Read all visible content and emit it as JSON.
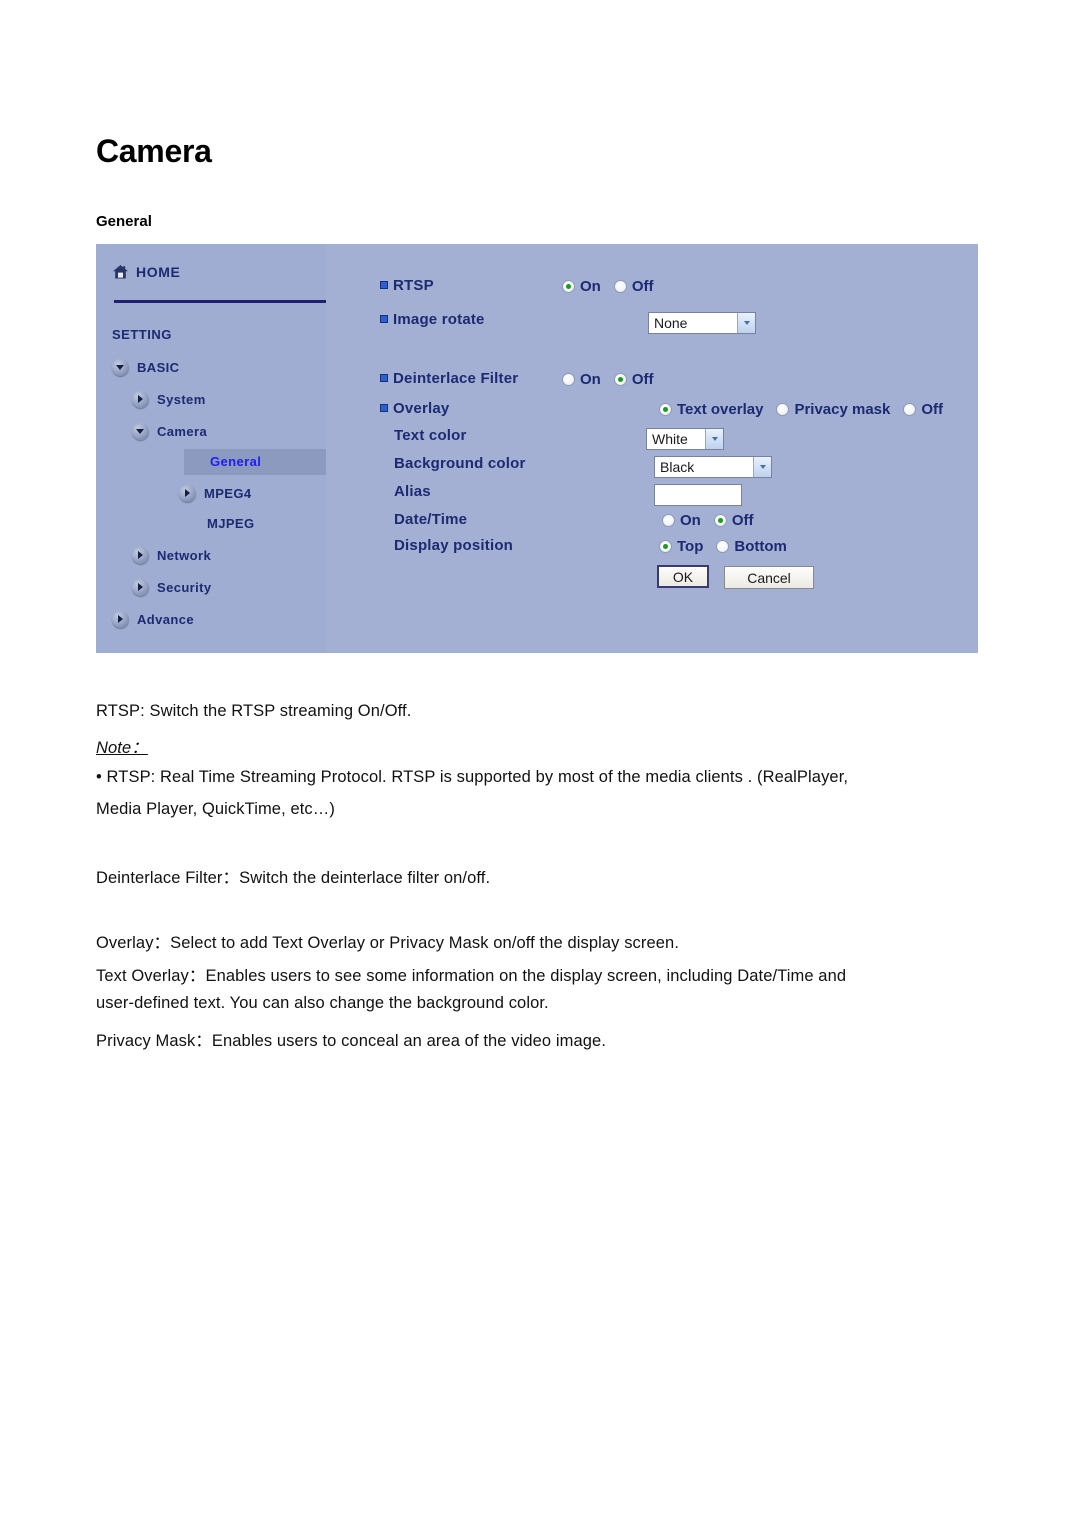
{
  "document": {
    "title": "Camera",
    "section": "General"
  },
  "ui": {
    "sidebar": {
      "home_label": "HOME",
      "setting_label": "SETTING",
      "items": [
        {
          "label": "BASIC",
          "level": 1,
          "toggle": "down",
          "current": false
        },
        {
          "label": "System",
          "level": 2,
          "toggle": "right",
          "current": false
        },
        {
          "label": "Camera",
          "level": 2,
          "toggle": "down",
          "current": false
        },
        {
          "label": "General",
          "level": 3,
          "toggle": "none",
          "current": true
        },
        {
          "label": "MPEG4",
          "level": 3,
          "toggle": "right",
          "current": false
        },
        {
          "label": "MJPEG",
          "level": 3,
          "toggle": "none",
          "current": false
        },
        {
          "label": "Network",
          "level": 2,
          "toggle": "right",
          "current": false
        },
        {
          "label": "Security",
          "level": 2,
          "toggle": "right",
          "current": false
        },
        {
          "label": "Advance",
          "level": 1,
          "toggle": "right",
          "current": false
        }
      ]
    },
    "form": {
      "rtsp": {
        "label": "RTSP",
        "options": [
          "On",
          "Off"
        ],
        "selected": "On"
      },
      "image_rotate": {
        "label": "Image rotate",
        "value": "None"
      },
      "deinterlace": {
        "label": "Deinterlace Filter",
        "options": [
          "On",
          "Off"
        ],
        "selected": "Off"
      },
      "overlay": {
        "label": "Overlay",
        "options": [
          "Text overlay",
          "Privacy mask",
          "Off"
        ],
        "selected": "Text overlay"
      },
      "text_color": {
        "label": "Text color",
        "value": "White"
      },
      "background_color": {
        "label": "Background color",
        "value": "Black"
      },
      "alias": {
        "label": "Alias",
        "value": "",
        "placeholder": ""
      },
      "date_time": {
        "label": "Date/Time",
        "options": [
          "On",
          "Off"
        ],
        "selected": "Off"
      },
      "display_position": {
        "label": "Display position",
        "options": [
          "Top",
          "Bottom"
        ],
        "selected": "Top"
      },
      "ok_label": "OK",
      "cancel_label": "Cancel"
    },
    "colors": {
      "panel_bg": "#a3b0d4",
      "sidebar_bg": "#9fadd2",
      "nav_text": "#1c2a72",
      "nav_current": "#1c1cff",
      "highlight": "#8d9ac0",
      "rule": "#1d2170",
      "radio_dot": "#1a9c1a"
    }
  },
  "body": {
    "line_rtsp": "RTSP: Switch the RTSP streaming On/Off.",
    "note_heading": "Note：",
    "note_line1": "• RTSP: Real Time Streaming Protocol. RTSP is supported by most of the media clients . (RealPlayer,",
    "note_line2": "Media Player, QuickTime, etc…)",
    "line_deinterlace": "Deinterlace Filter：Switch the deinterlace filter on/off.",
    "line_overlay": "Overlay：Select to add Text Overlay or Privacy Mask on/off the display screen.",
    "line_text_overlay_1": "Text Overlay：Enables users to see some information on the display screen, including Date/Time and",
    "line_text_overlay_2": "user-defined text. You can also change the background color.",
    "line_privacy_mask": "Privacy Mask：Enables users to conceal an area of the video image."
  }
}
